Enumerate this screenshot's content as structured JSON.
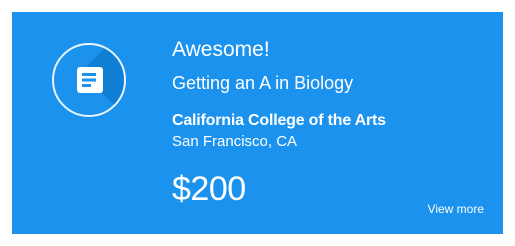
{
  "card": {
    "icon": "document-icon",
    "headline": "Awesome!",
    "subheadline": "Getting an A in Biology",
    "college": "California College of the Arts",
    "location": "San Francisco, CA",
    "amount": "$200",
    "view_more_label": "View more"
  },
  "colors": {
    "card_background": "#1a92ee",
    "icon_shadow": "#0f7ed3",
    "text": "#ffffff"
  }
}
